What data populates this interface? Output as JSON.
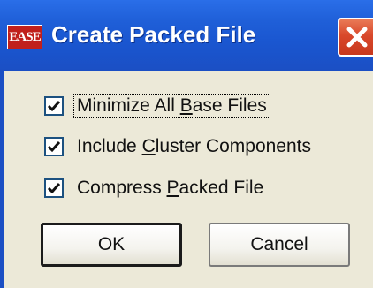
{
  "window": {
    "title": "Create Packed File",
    "app_icon_text": "EASE",
    "app_icon_name": "ease-logo-icon",
    "close_icon_name": "close-icon"
  },
  "options": [
    {
      "pre": "Minimize All ",
      "accel": "B",
      "post": "ase Files",
      "checked": true,
      "focused": true
    },
    {
      "pre": "Include ",
      "accel": "C",
      "post": "luster Components",
      "checked": true,
      "focused": false
    },
    {
      "pre": "Compress ",
      "accel": "P",
      "post": "acked File",
      "checked": true,
      "focused": false
    }
  ],
  "buttons": {
    "ok_label": "OK",
    "cancel_label": "Cancel"
  },
  "colors": {
    "titlebar": "#1f5fd8",
    "close_button": "#d9482b",
    "app_icon": "#c0201c",
    "dialog_background": "#ece9d8"
  }
}
